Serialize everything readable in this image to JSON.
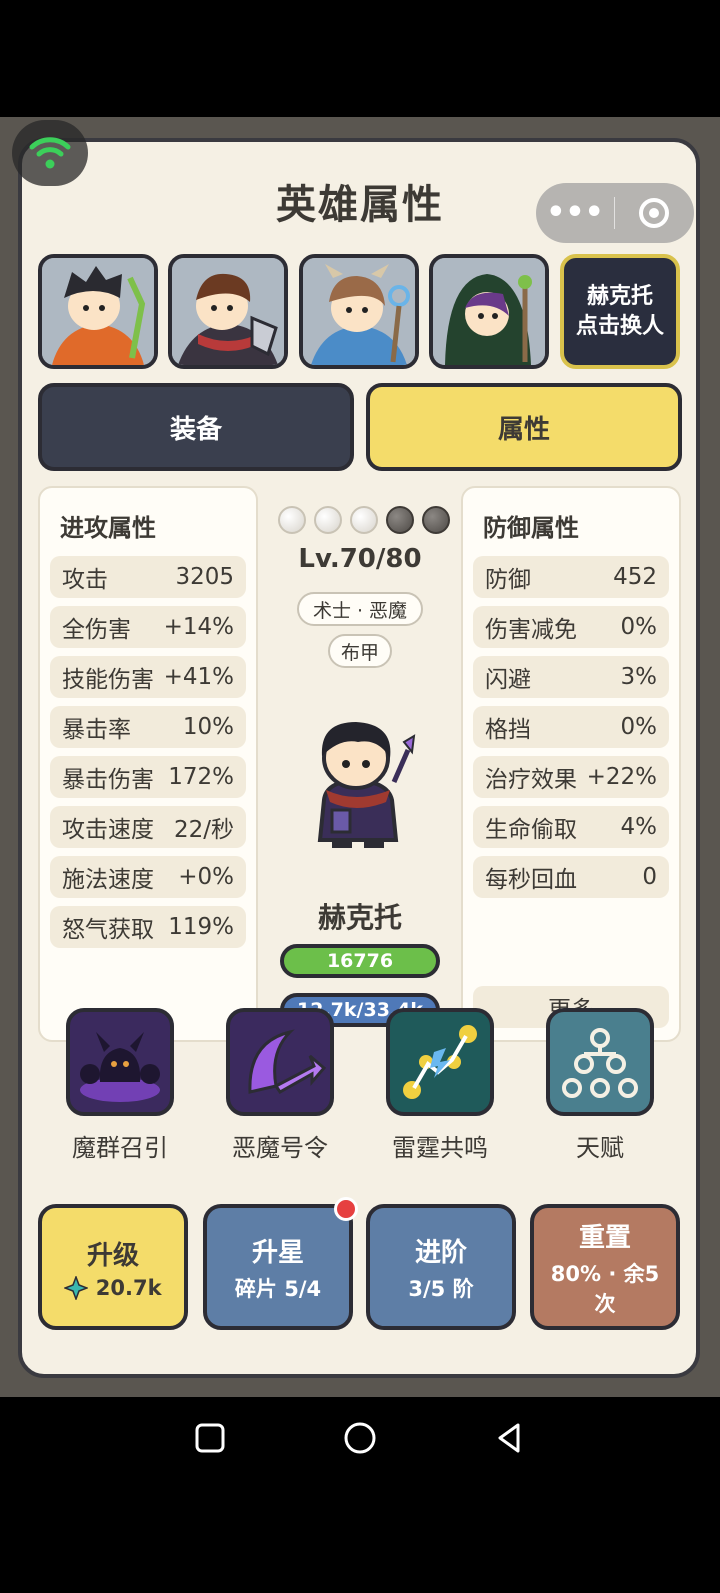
{
  "page": {
    "title": "英雄属性"
  },
  "capsule": {
    "dots_label": "•••"
  },
  "heroes": [
    {
      "name": "hero-1"
    },
    {
      "name": "hero-2"
    },
    {
      "name": "hero-3"
    },
    {
      "name": "hero-4"
    },
    {
      "active_name": "赫克托",
      "active_hint": "点击换人"
    }
  ],
  "tabs": {
    "equip": "装备",
    "attr": "属性"
  },
  "offense": {
    "title": "进攻属性",
    "rows": [
      {
        "label": "攻击",
        "value": "3205"
      },
      {
        "label": "全伤害",
        "value": "+14%"
      },
      {
        "label": "技能伤害",
        "value": "+41%"
      },
      {
        "label": "暴击率",
        "value": "10%"
      },
      {
        "label": "暴击伤害",
        "value": "172%"
      },
      {
        "label": "攻击速度",
        "value": "22/秒"
      },
      {
        "label": "施法速度",
        "value": "+0%"
      },
      {
        "label": "怒气获取",
        "value": "119%"
      }
    ]
  },
  "defense": {
    "title": "防御属性",
    "rows": [
      {
        "label": "防御",
        "value": "452"
      },
      {
        "label": "伤害减免",
        "value": "0%"
      },
      {
        "label": "闪避",
        "value": "3%"
      },
      {
        "label": "格挡",
        "value": "0%"
      },
      {
        "label": "治疗效果",
        "value": "+22%"
      },
      {
        "label": "生命偷取",
        "value": "4%"
      },
      {
        "label": "每秒回血",
        "value": "0"
      }
    ],
    "more": "更多"
  },
  "hero": {
    "stars_filled": 3,
    "stars_total": 5,
    "level": "Lv.70/80",
    "class_tag": "术士 · 恶魔",
    "armor_tag": "布甲",
    "name": "赫克托",
    "hp": "16776",
    "exp": "12.7k/33.4k"
  },
  "skills": [
    {
      "label": "魔群召引",
      "icon": "demon-horde-icon",
      "color": "#3b2a5e"
    },
    {
      "label": "恶魔号令",
      "icon": "demon-horn-icon",
      "color": "#3b2a5e"
    },
    {
      "label": "雷霆共鸣",
      "icon": "thunder-icon",
      "color": "#1f5a5a"
    },
    {
      "label": "天赋",
      "icon": "talent-tree-icon",
      "color": "#4a7f8e"
    }
  ],
  "actions": {
    "upgrade": {
      "label": "升级",
      "cost": "20.7k"
    },
    "star_up": {
      "label": "升星",
      "sub": "碎片 5/4"
    },
    "advance": {
      "label": "进阶",
      "sub": "3/5 阶"
    },
    "reset": {
      "label": "重置",
      "sub": "80% · 余5次"
    }
  }
}
